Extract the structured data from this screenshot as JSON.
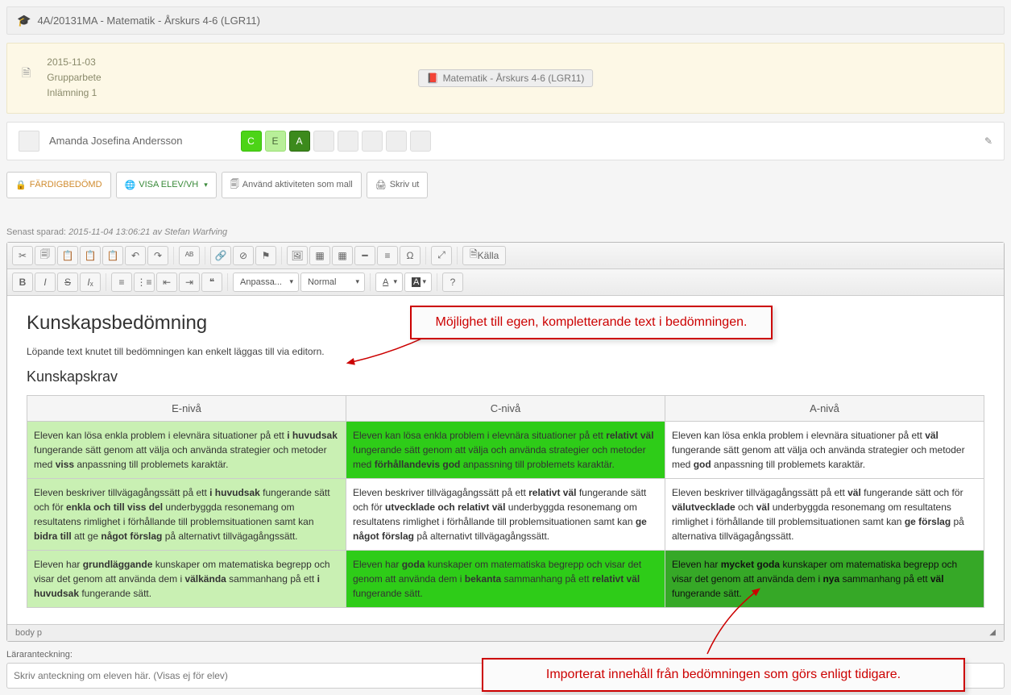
{
  "header": {
    "title": "4A/20131MA - Matematik - Årskurs 4-6 (LGR11)"
  },
  "info": {
    "date": "2015-11-03",
    "line2": "Grupparbete",
    "line3": "Inlämning 1",
    "badge": "Matematik - Årskurs 4-6 (LGR11)"
  },
  "student": {
    "name": "Amanda Josefina Andersson",
    "grades": {
      "c": "C",
      "e": "E",
      "a": "A"
    }
  },
  "buttons": {
    "fardig": "FÄRDIGBEDÖMD",
    "visa": "VISA ELEV/VH",
    "mall": "Använd aktiviteten som mall",
    "skriv": "Skriv ut"
  },
  "saved": {
    "prefix": "Senast sparad: ",
    "time": "2015-11-04 13:06:21 av Stefan Warfving"
  },
  "toolbar": {
    "kalla": "Källa",
    "anpassa": "Anpassa...",
    "normal": "Normal",
    "a1": "A",
    "a2": "A",
    "help": "?"
  },
  "content": {
    "h1": "Kunskapsbedömning",
    "p": "Löpande text knutet till bedömningen kan enkelt läggas till via editorn.",
    "h2": "Kunskapskrav",
    "cols": {
      "e": "E-nivå",
      "c": "C-nivå",
      "a": "A-nivå"
    },
    "rows": [
      {
        "e": "Eleven kan lösa enkla problem i elevnära situationer på ett <b>i huvudsak</b> fungerande sätt genom att välja och använda strategier och metoder med <b>viss</b> anpassning till problemets karaktär.",
        "c": "Eleven kan lösa enkla problem i elevnära situationer på ett <b>relativt väl</b> fungerande sätt genom att välja och använda strategier och metoder med <b>förhållandevis god</b> anpassning till problemets karaktär.",
        "a": "Eleven kan lösa enkla problem i elevnära situationer på ett <b>väl</b> fungerande sätt genom att välja och använda strategier och metoder med <b>god</b> anpassning till problemets karaktär.",
        "classes": {
          "e": "lightgreen",
          "c": "green",
          "a": ""
        }
      },
      {
        "e": "Eleven beskriver tillvägagångssätt på ett <b>i huvudsak</b> fungerande sätt och för <b>enkla och till viss del</b> underbyggda resonemang om resultatens rimlighet i förhållande till problemsituationen samt kan <b>bidra till</b> att ge <b>något förslag</b> på alternativt tillvägagångssätt.",
        "c": "Eleven beskriver tillvägagångssätt på ett <b>relativt väl</b> fungerande sätt och för <b>utvecklade och relativt väl</b> underbyggda resonemang om resultatens rimlighet i förhållande till problemsituationen samt kan <b>ge något förslag</b> på alternativt tillvägagångssätt.",
        "a": "Eleven beskriver tillvägagångssätt på ett <b>väl</b> fungerande sätt och för <b>välutvecklade</b> och <b>väl</b> underbyggda resonemang om resultatens rimlighet i förhållande till problemsituationen samt kan <b>ge förslag</b> på alternativa tillvägagångssätt.",
        "classes": {
          "e": "lightgreen",
          "c": "",
          "a": ""
        }
      },
      {
        "e": "Eleven har <b>grundläggande</b> kunskaper om matematiska begrepp och visar det genom att använda dem i <b>välkända</b> sammanhang på ett <b>i huvudsak</b> fungerande sätt.",
        "c": "Eleven har <b>goda</b> kunskaper om matematiska begrepp och visar det genom att använda dem i <b>bekanta</b> sammanhang på ett <b>relativt väl</b> fungerande sätt.",
        "a": "Eleven har <b>mycket goda</b> kunskaper om matematiska begrepp och visar det genom att använda dem i <b>nya</b> sammanhang på ett <b>väl</b> fungerande sätt.",
        "classes": {
          "e": "lightgreen",
          "c": "green",
          "a": "darkgreen"
        }
      }
    ]
  },
  "footer": {
    "path": "body   p"
  },
  "teacher": {
    "label": "Läraranteckning:",
    "placeholder": "Skriv anteckning om eleven här. (Visas ej för elev)"
  },
  "callouts": {
    "c1": "Möjlighet till egen, kompletterande text i bedömningen.",
    "c2": "Importerat innehåll från bedömningen som görs enligt tidigare."
  }
}
